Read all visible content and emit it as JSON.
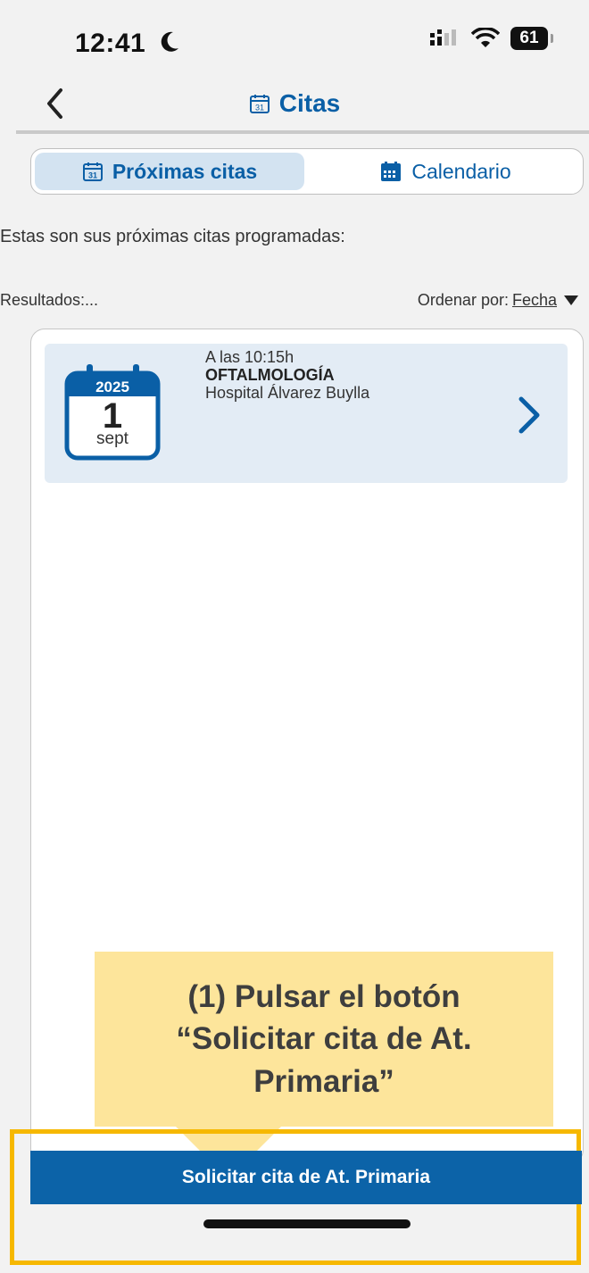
{
  "status_bar": {
    "time": "12:41",
    "battery": "61"
  },
  "header": {
    "title": "Citas"
  },
  "tabs": [
    {
      "label": "Próximas citas",
      "active": true
    },
    {
      "label": "Calendario",
      "active": false
    }
  ],
  "intro": "Estas son sus próximas citas programadas:",
  "results_label": "Resultados:...",
  "sort": {
    "prefix": "Ordenar por:",
    "value": "Fecha"
  },
  "appointments": [
    {
      "year": "2025",
      "day": "1",
      "month": "sept",
      "time": "A las 10:15h",
      "specialty": "OFTALMOLOGÍA",
      "hospital": "Hospital Álvarez Buylla"
    }
  ],
  "callout": {
    "text": "(1) Pulsar el botón “Solicitar cita de At. Primaria”"
  },
  "primary_button": {
    "label": "Solicitar cita de At. Primaria"
  },
  "colors": {
    "brand": "#0c63a8",
    "accent_highlight": "#f6b800",
    "callout": "#fde59b"
  }
}
